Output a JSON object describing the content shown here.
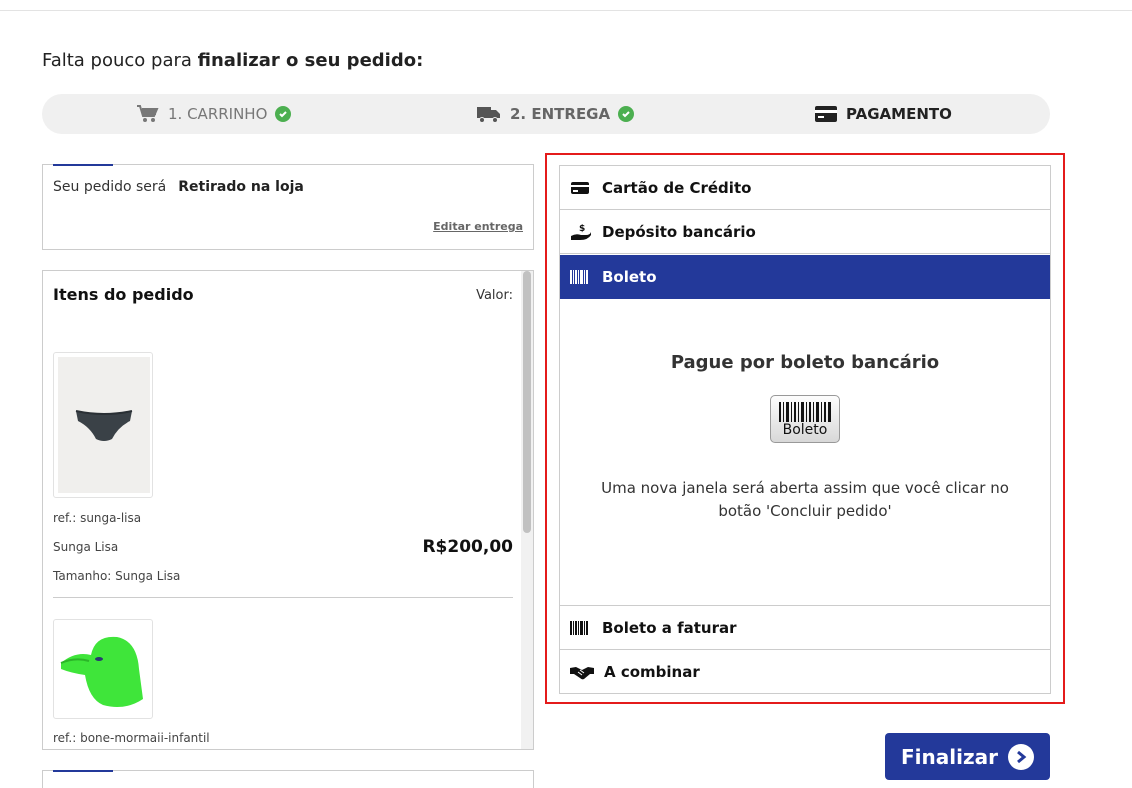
{
  "header": {
    "title_prefix": "Falta pouco para ",
    "title_bold": "finalizar o seu pedido:"
  },
  "steps": [
    {
      "label": "1. CARRINHO",
      "icon": "cart-icon",
      "done": true
    },
    {
      "label": "2. ENTREGA",
      "icon": "truck-icon",
      "done": true
    },
    {
      "label": "PAGAMENTO",
      "icon": "card-icon",
      "done": false
    }
  ],
  "delivery": {
    "label": "Seu pedido será",
    "value": "Retirado na loja",
    "edit_label": "Editar entrega"
  },
  "items": {
    "title": "Itens do pedido",
    "valor_label": "Valor:",
    "list": [
      {
        "ref": "ref.: sunga-lisa",
        "name": "Sunga Lisa",
        "price": "R$200,00",
        "size": "Tamanho: Sunga Lisa"
      },
      {
        "ref": "ref.: bone-mormaii-infantil"
      }
    ]
  },
  "payment": {
    "methods": [
      {
        "label": "Cartão de Crédito",
        "icon": "credit-card-icon"
      },
      {
        "label": "Depósito bancário",
        "icon": "hand-money-icon"
      },
      {
        "label": "Boleto",
        "icon": "barcode-icon",
        "active": true
      },
      {
        "label": "Boleto a faturar",
        "icon": "barcode-icon"
      },
      {
        "label": "A combinar",
        "icon": "handshake-icon"
      }
    ],
    "panel": {
      "title": "Pague por boleto bancário",
      "logo_text": "Boleto",
      "description": "Uma nova janela será aberta assim que você clicar no botão 'Concluir pedido'"
    }
  },
  "actions": {
    "finalizar_label": "Finalizar"
  },
  "colors": {
    "primary": "#23399a",
    "success": "#4caf50",
    "highlight": "#e41b1b"
  }
}
